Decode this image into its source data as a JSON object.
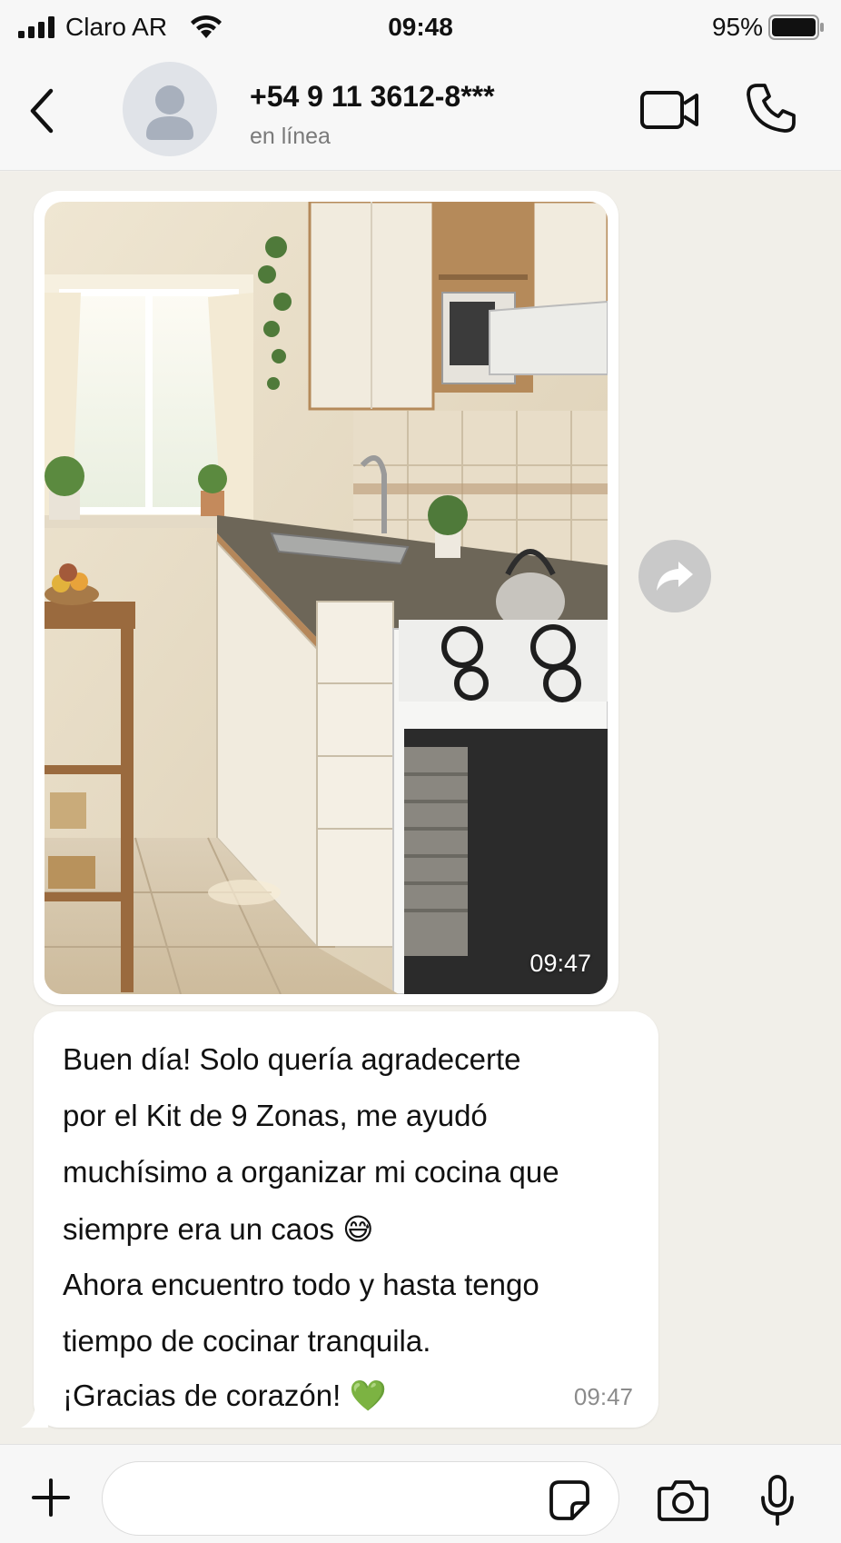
{
  "status_bar": {
    "carrier": "Claro AR",
    "time": "09:48",
    "battery_percent": "95%"
  },
  "header": {
    "contact_name": "+54 9 11 3612-8***",
    "contact_status": "en línea",
    "icons": {
      "back": "chevron-left-icon",
      "avatar": "person-icon",
      "video": "video-camera-icon",
      "call": "phone-icon"
    }
  },
  "messages": [
    {
      "type": "image",
      "time": "09:47"
    },
    {
      "type": "text",
      "lines": [
        "Buen día! Solo quería agradecerte",
        "por el Kit de 9 Zonas, me ayudó",
        "muchísimo a organizar mi cocina que",
        "siempre era un caos 😅",
        "Ahora encuentro todo y hasta tengo",
        "tiempo de cocinar tranquila.",
        "¡Gracias de corazón! 💚"
      ],
      "time": "09:47"
    }
  ],
  "forward_icon": "forward-arrow-icon",
  "input_bar": {
    "placeholder": "",
    "icons": {
      "plus": "plus-icon",
      "sticker": "sticker-icon",
      "camera": "camera-icon",
      "mic": "microphone-icon"
    }
  },
  "colors": {
    "chat_background": "#f1efe9",
    "bubble": "#ffffff",
    "bar_background": "#f7f7f7",
    "secondary_text": "#7a7a7a"
  }
}
